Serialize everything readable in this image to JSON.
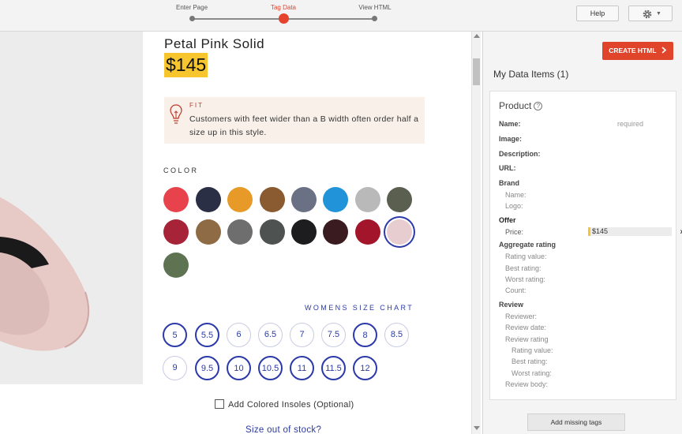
{
  "wizard": {
    "steps": [
      {
        "label": "Enter Page"
      },
      {
        "label": "Tag Data"
      },
      {
        "label": "View HTML"
      }
    ],
    "active_step": 1
  },
  "toolbar": {
    "help_label": "Help",
    "settings_icon": "gear-icon"
  },
  "product": {
    "title": "Petal Pink Solid",
    "price": "$145",
    "fit": {
      "label": "FIT",
      "text": "Customers with feet wider than a B width often order half a size up in this style."
    },
    "color_label": "COLOR",
    "swatches": [
      {
        "color": "#e8434c"
      },
      {
        "color": "#2b2f45"
      },
      {
        "color": "#e89a29"
      },
      {
        "color": "#8a5a30"
      },
      {
        "color": "#6a7184"
      },
      {
        "color": "#2193d9"
      },
      {
        "color": "#b9b9b9"
      },
      {
        "color": "#5a5f50"
      },
      {
        "color": "#a72438"
      },
      {
        "color": "#8e6b45"
      },
      {
        "color": "#6e6e6e"
      },
      {
        "color": "#4e5250"
      },
      {
        "color": "#1d1d1f"
      },
      {
        "color": "#3a1c20"
      },
      {
        "color": "#a3152a"
      },
      {
        "color": "#e8cdd0"
      },
      {
        "color": "#5d7352"
      }
    ],
    "selected_swatch": 15,
    "size_chart_label": "WOMENS SIZE CHART",
    "sizes": [
      {
        "label": "5",
        "available": true
      },
      {
        "label": "5.5",
        "available": true
      },
      {
        "label": "6",
        "available": false
      },
      {
        "label": "6.5",
        "available": false
      },
      {
        "label": "7",
        "available": false
      },
      {
        "label": "7.5",
        "available": false
      },
      {
        "label": "8",
        "available": true
      },
      {
        "label": "8.5",
        "available": false
      },
      {
        "label": "9",
        "available": false
      },
      {
        "label": "9.5",
        "available": true
      },
      {
        "label": "10",
        "available": true
      },
      {
        "label": "10.5",
        "available": true
      },
      {
        "label": "11",
        "available": true
      },
      {
        "label": "11.5",
        "available": true
      },
      {
        "label": "12",
        "available": true
      }
    ],
    "insoles_label": "Add Colored Insoles (Optional)",
    "stock_link": "Size out of stock?"
  },
  "panel": {
    "create_button": "CREATE HTML",
    "my_items": "My Data Items (1)",
    "card_title": "Product",
    "required_text": "required",
    "price_value": "$145",
    "remove_label": "x",
    "add_missing": "Add missing tags",
    "fields": [
      {
        "label": "Name:",
        "style": "b"
      },
      {
        "label": "Image:",
        "style": "b"
      },
      {
        "label": "Description:",
        "style": "b"
      },
      {
        "label": "URL:",
        "style": "b"
      },
      {
        "label": "Brand",
        "style": "b"
      },
      {
        "label": "Name:",
        "style": "sub"
      },
      {
        "label": "Logo:",
        "style": "sub"
      },
      {
        "label": "Offer",
        "style": "b"
      },
      {
        "label": "Price:",
        "style": "plain"
      },
      {
        "label": "Aggregate rating",
        "style": "b"
      },
      {
        "label": "Rating value:",
        "style": "sub"
      },
      {
        "label": "Best rating:",
        "style": "sub"
      },
      {
        "label": "Worst rating:",
        "style": "sub"
      },
      {
        "label": "Count:",
        "style": "sub"
      },
      {
        "label": "Review",
        "style": "b"
      },
      {
        "label": "Reviewer:",
        "style": "sub"
      },
      {
        "label": "Review date:",
        "style": "sub"
      },
      {
        "label": "Review rating",
        "style": "sub"
      },
      {
        "label": "Rating value:",
        "style": "sub"
      },
      {
        "label": "Best rating:",
        "style": "sub"
      },
      {
        "label": "Worst rating:",
        "style": "sub"
      },
      {
        "label": "Review body:",
        "style": "sub"
      }
    ]
  }
}
